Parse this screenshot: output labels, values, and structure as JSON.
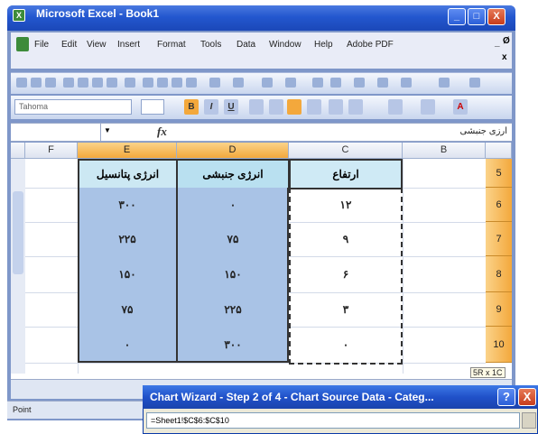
{
  "window": {
    "title": "Microsoft Excel - Book1",
    "minimize": "_",
    "maximize": "□",
    "close": "X"
  },
  "menu": [
    "File",
    "Edit",
    "View",
    "Insert",
    "Format",
    "Tools",
    "Data",
    "Window",
    "Help",
    "Adobe PDF"
  ],
  "menu_right": {
    "minimize": "_",
    "restore": "Ø",
    "close": "x"
  },
  "toolbar": {
    "font_name": "Tahoma",
    "bold": "B",
    "italic": "I",
    "underline": "U",
    "font_color": "A"
  },
  "formula_bar": {
    "name_box": "",
    "fx": "fx",
    "content": "ارزی جنبشی"
  },
  "grid": {
    "columns": [
      "F",
      "E",
      "D",
      "C",
      "B"
    ],
    "rows": [
      "5",
      "6",
      "7",
      "8",
      "9",
      "10"
    ],
    "headers": {
      "E": "انرژی پتانسیل",
      "D": "انرژی جنبشی",
      "C": "ارتفاع"
    },
    "data": [
      {
        "E": "۳۰۰",
        "D": "۰",
        "C": "۱۲"
      },
      {
        "E": "۲۲۵",
        "D": "۷۵",
        "C": "۹"
      },
      {
        "E": "۱۵۰",
        "D": "۱۵۰",
        "C": "۶"
      },
      {
        "E": "۷۵",
        "D": "۲۲۵",
        "C": "۳"
      },
      {
        "E": "۰",
        "D": "۳۰۰",
        "C": "۰"
      }
    ]
  },
  "size_tip": "5R x 1C",
  "status": "Point",
  "dialog": {
    "title": "Chart Wizard - Step 2 of 4 - Chart Source Data - Categ...",
    "help": "?",
    "close": "X",
    "range": "=Sheet1!$C$6:$C$10"
  }
}
